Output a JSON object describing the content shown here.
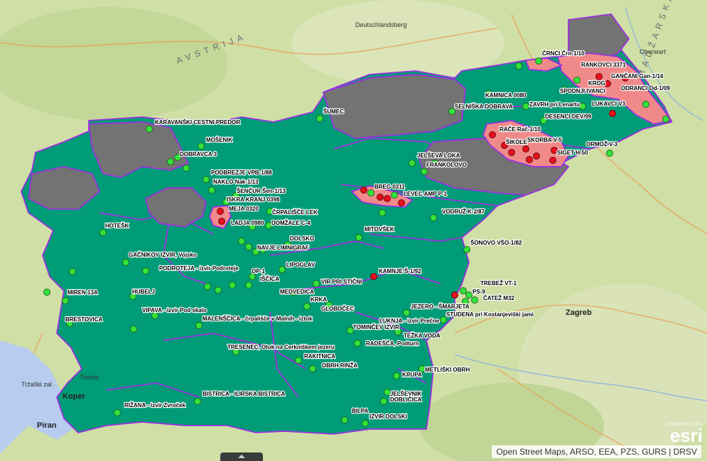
{
  "map": {
    "attribution": "Open Street Maps, ARSO, EEA, PZS, GURS | DRSV",
    "powered_by": "POWERED BY",
    "logo_text": "esri",
    "colors": {
      "zone_good": "#009b77",
      "zone_grey": "#737373",
      "zone_risk": "#f08a8a",
      "boundary": "#9b30e0",
      "point_good": "#33e33a",
      "point_bad": "#e8101c",
      "sea": "#b7ccef"
    }
  },
  "background_labels": {
    "avstrija": "AVSTRIJA",
    "madzarska": "MADŽARSKA",
    "zagreb": "Zagreb",
    "koper": "Koper",
    "piran": "Piran",
    "trzaski_zaliv": "Tržaški zal.",
    "trieste": "Trieste",
    "deutschlandsberg": "Deutschlandsberg",
    "oberwart": "Oberwart"
  },
  "stations": {
    "crnci": "ČRNCI Črn-1/10",
    "rankovci": "RANKOVCI 3371",
    "gancani": "GANČANI Gan-1/14",
    "krog": "KROG",
    "odranci": "ODRANCI Od-1/09",
    "spodnji_ivanci": "SPODNJI IVANCI",
    "lukavci": "LUKAVCI V3",
    "kamnica": "KAMNICA 0080",
    "selniska": "SELNIŠKA DOBRAVA",
    "zavrh": "ZAVRH pri Lenartu",
    "desenci": "DESENCI DEV/99",
    "race": "RAČE Rač-1/10",
    "sikole": "ŠIKOLE",
    "skorba": "SKORBA V-5",
    "ormoz": "ORMOŽ V-3",
    "siget": "SIGET H-50",
    "sumec": "ŠUMEC",
    "karavanski": "KARAVANŠKI CESTNI PREDOR",
    "mosenik": "MOŠENIK",
    "dobravca": "DOBRAVCA 3",
    "podbrezje": "PODBREZJE VPB-1/88",
    "naklo": "NAKLO Nak-1/13",
    "sencur": "ŠENČUR Šen-1/13",
    "iskra": "ISKRA KRANJ 0398",
    "meja": "MEJA 0320",
    "crpalisce_lek": "ČRPALIŠČE LEK",
    "ladja": "LADJA 0980",
    "domzale": "DOMŽALE C-4",
    "jelseva": "JELŠEVA LOKA",
    "frankolovo": "FRANKOLOVO",
    "breg": "BREG 0311",
    "levec": "LEVEC AMP P-1",
    "vodruz": "VODRUŽ K-2/87",
    "mitovsek": "MITOVŠEK",
    "hotesk": "HOTEŠK",
    "dolsko": "DOLSKO",
    "navje": "NAVJE LIMNIGRAF",
    "sonovo": "ŠONOVO VŠO-1/82",
    "gacnikov": "GAČNIKOV IZVIR, Vojsko",
    "podroteja": "PODROTEJA - izvir Podroteje",
    "lipoglav": "LIPOGLAV",
    "kamnje": "KAMNJE Š-1/92",
    "op1": "OP-1",
    "iscica": "IŠČICA",
    "vir_stični": "VIR PRI STIČNI",
    "trebez": "TREBEŽ VT-1",
    "ps9": "PS-9",
    "catez": "ČATEŽ M32",
    "miren": "MIREN 13A",
    "hubelj": "HUBELJ",
    "medvedica": "MEDVEDICA",
    "krka": "KRKA",
    "globocec": "GLOBOČEC",
    "jezero": "JEZERO - ŠMARJETA",
    "studena": "STUDENA pri Kostanjeviški jami",
    "vipava": "VIPAVA - izvir Pod skalo",
    "malenscica": "MALENŠČICA - črpališče v Malnih - iztok",
    "luknja": "LUKNJA - izvir Prečne",
    "brestovica": "BRESTOVICA",
    "tomincev": "TOMINČEV IZVIR",
    "tezka": "TEŽKA VODA",
    "radesca": "RADEŠČA, Podturn",
    "tresenec": "TRESENEC, Otok na Cerkniškem jezeru",
    "rakitnica": "RAKITNICA",
    "obrh_rinza": "OBRH RINŽA",
    "metliski": "METLIŠKI OBRH",
    "krupa": "KRUPA",
    "bistrica": "BISTRICA - ILIRSKA BISTRICA",
    "jelsevnik": "JELŠEVNIK",
    "doblicica": "DOBLIČICA",
    "rizana": "RIŽANA - izvir Zvroček",
    "bilpa": "BILPA",
    "izvir_dolski": "IZVIR DOLSKI"
  }
}
